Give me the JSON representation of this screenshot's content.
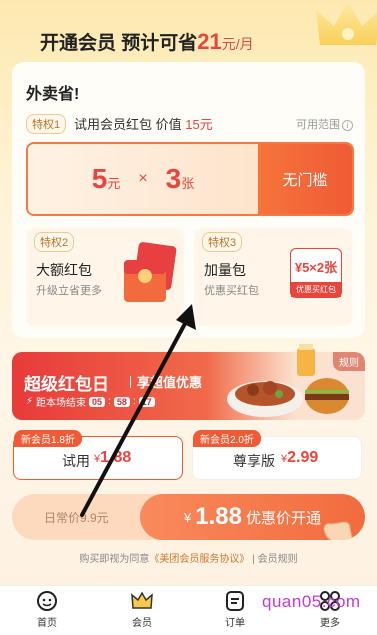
{
  "header": {
    "prefix": "开通会员 预计可省",
    "amount": "21",
    "unit": "元/月"
  },
  "card": {
    "title": "外卖省!",
    "priv1": {
      "tag": "特权1",
      "desc": "试用会员红包 价值",
      "value": "15元",
      "scope": "可用范围"
    },
    "coupon": {
      "amount": "5",
      "amount_unit": "元",
      "times": "×",
      "count": "3",
      "count_unit": "张",
      "condition": "无门槛"
    },
    "priv2": {
      "tag": "特权2",
      "title": "大额红包",
      "desc": "升级立省更多"
    },
    "priv3": {
      "tag": "特权3",
      "title": "加量包",
      "desc": "优惠买红包",
      "mini_value": "¥5×2张",
      "mini_label": "优惠买红包"
    }
  },
  "banner": {
    "title": "超级红包日",
    "subtitle": "享超值优惠",
    "timer_label": "距本场结束",
    "hours": "05",
    "minutes": "58",
    "seconds": "17",
    "rule": "规则"
  },
  "plans": [
    {
      "tag": "新会员1.8折",
      "name": "试用",
      "currency": "¥",
      "price": "1.88",
      "selected": true
    },
    {
      "tag": "新会员2.0折",
      "name": "尊享版",
      "currency": "¥",
      "price": "2.99",
      "selected": false
    }
  ],
  "cta": {
    "daily_price": "日常价9.9元",
    "currency": "¥",
    "price": "1.88",
    "label": "优惠价开通"
  },
  "agreement": {
    "prefix": "购买即视为同意",
    "link": "《美团会员服务协议》",
    "separator": "|",
    "rules": "会员规则"
  },
  "tabbar": [
    {
      "label": "首页",
      "icon": "home-face-icon"
    },
    {
      "label": "会员",
      "icon": "crown-icon"
    },
    {
      "label": "订单",
      "icon": "order-icon"
    },
    {
      "label": "更多",
      "icon": "more-icon"
    }
  ],
  "watermark": "quan05.com",
  "colors": {
    "accent": "#e8453c",
    "orange": "#f26b3e",
    "brand_yellow": "#fde9b0"
  }
}
